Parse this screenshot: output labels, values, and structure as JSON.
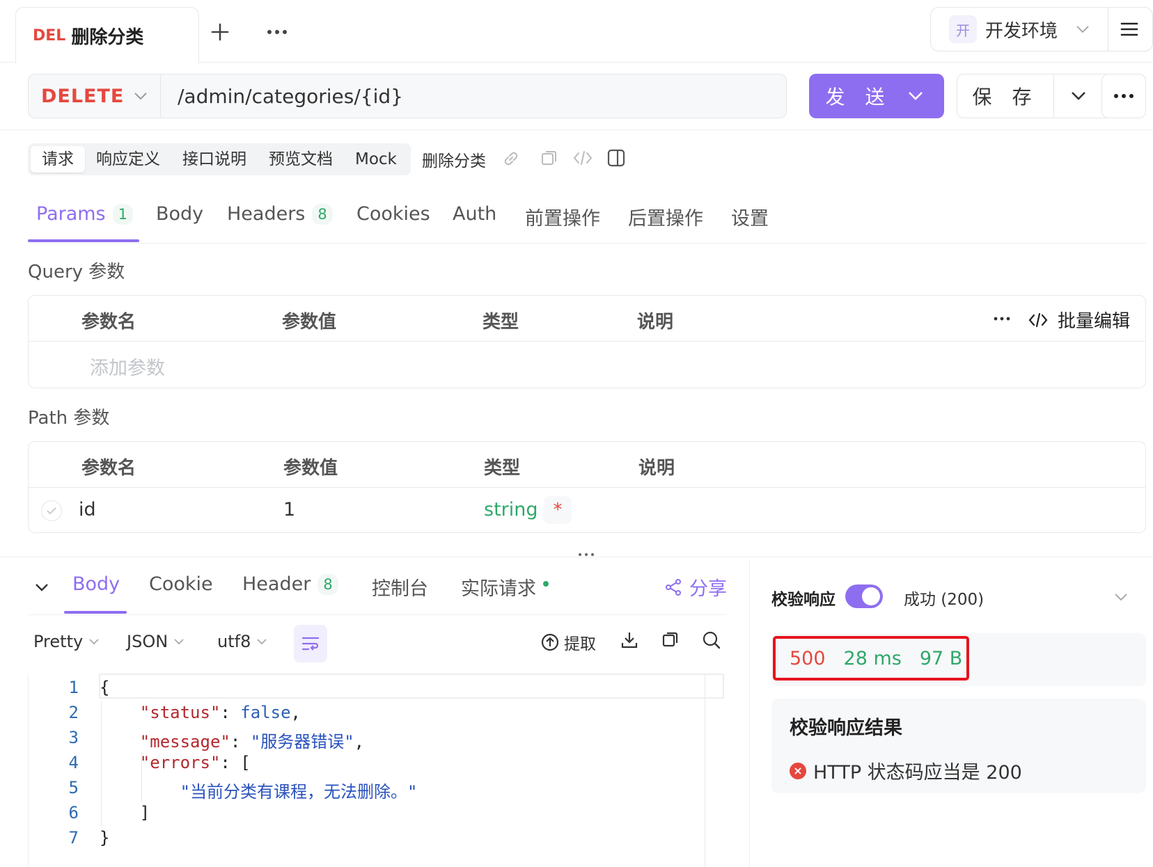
{
  "tab": {
    "method": "DEL",
    "title": "删除分类"
  },
  "env": {
    "badge": "开",
    "name": "开发环境"
  },
  "request": {
    "method": "DELETE",
    "url": "/admin/categories/{id}",
    "send_label": "发 送",
    "save_label": "保 存"
  },
  "subtabs": [
    "请求",
    "响应定义",
    "接口说明",
    "预览文档",
    "Mock"
  ],
  "api_name": "删除分类",
  "param_tabs": [
    {
      "label": "Params",
      "count": "1"
    },
    {
      "label": "Body"
    },
    {
      "label": "Headers",
      "count": "8"
    },
    {
      "label": "Cookies"
    },
    {
      "label": "Auth"
    },
    {
      "label": "前置操作"
    },
    {
      "label": "后置操作"
    },
    {
      "label": "设置"
    }
  ],
  "query": {
    "title": "Query 参数",
    "headers": [
      "参数名",
      "参数值",
      "类型",
      "说明"
    ],
    "bulk_edit": "批量编辑",
    "add_placeholder": "添加参数"
  },
  "path": {
    "title": "Path 参数",
    "headers": [
      "参数名",
      "参数值",
      "类型",
      "说明"
    ],
    "rows": [
      {
        "name": "id",
        "value": "1",
        "type": "string",
        "required": "*"
      }
    ]
  },
  "response_tabs": [
    {
      "label": "Body"
    },
    {
      "label": "Cookie"
    },
    {
      "label": "Header",
      "count": "8"
    },
    {
      "label": "控制台"
    },
    {
      "label": "实际请求"
    }
  ],
  "share_label": "分享",
  "format": {
    "view": "Pretty",
    "lang": "JSON",
    "encoding": "utf8"
  },
  "extract_label": "提取",
  "code": {
    "line_numbers": [
      "1",
      "2",
      "3",
      "4",
      "5",
      "6",
      "7"
    ],
    "l1": "{",
    "l2_key": "\"status\"",
    "l2_colon": ": ",
    "l2_val": "false",
    "l2_end": ",",
    "l3_key": "\"message\"",
    "l3_colon": ": ",
    "l3_val": "\"服务器错误\"",
    "l3_end": ",",
    "l4_key": "\"errors\"",
    "l4_rest": ": [",
    "l5_val": "\"当前分类有课程，无法删除。\"",
    "l6": "]",
    "l7": "}"
  },
  "validation": {
    "label": "校验响应",
    "enabled": true,
    "status": "成功 (200)",
    "code": "500",
    "time": "28 ms",
    "size": "97 B",
    "result_title": "校验响应结果",
    "result_item": "HTTP 状态码应当是 200"
  },
  "colors": {
    "accent": "#8e6ef0",
    "delete": "#e5483f",
    "success": "#2fa86a",
    "highlight_border": "#e5151f"
  }
}
